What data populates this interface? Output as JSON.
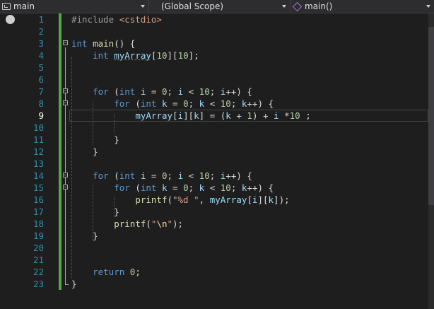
{
  "navbar": {
    "project": "main",
    "scope": "(Global Scope)",
    "member": "main()"
  },
  "editor": {
    "current_line": 9,
    "lines": [
      {
        "n": "1",
        "tokens": [
          {
            "t": "#include ",
            "c": "pp"
          },
          {
            "t": "<cstdio>",
            "c": "inc"
          }
        ]
      },
      {
        "n": "2",
        "tokens": []
      },
      {
        "n": "3",
        "tokens": [
          {
            "t": "int",
            "c": "kw"
          },
          {
            "t": " "
          },
          {
            "t": "main",
            "c": "fn"
          },
          {
            "t": "() {"
          }
        ]
      },
      {
        "n": "4",
        "tokens": [
          {
            "t": "    "
          },
          {
            "t": "int",
            "c": "kw"
          },
          {
            "t": " "
          },
          {
            "t": "myArray",
            "c": "var"
          },
          {
            "t": "["
          },
          {
            "t": "10",
            "c": "num"
          },
          {
            "t": "]["
          },
          {
            "t": "10",
            "c": "num"
          },
          {
            "t": "];"
          }
        ]
      },
      {
        "n": "5",
        "tokens": []
      },
      {
        "n": "6",
        "tokens": []
      },
      {
        "n": "7",
        "tokens": [
          {
            "t": "    "
          },
          {
            "t": "for",
            "c": "kw"
          },
          {
            "t": " ("
          },
          {
            "t": "int",
            "c": "kw"
          },
          {
            "t": " "
          },
          {
            "t": "i",
            "c": "var"
          },
          {
            "t": " = "
          },
          {
            "t": "0",
            "c": "num"
          },
          {
            "t": "; "
          },
          {
            "t": "i",
            "c": "var"
          },
          {
            "t": " < "
          },
          {
            "t": "10",
            "c": "num"
          },
          {
            "t": "; "
          },
          {
            "t": "i",
            "c": "var"
          },
          {
            "t": "++) {"
          }
        ]
      },
      {
        "n": "8",
        "tokens": [
          {
            "t": "        "
          },
          {
            "t": "for",
            "c": "kw"
          },
          {
            "t": " ("
          },
          {
            "t": "int",
            "c": "kw"
          },
          {
            "t": " "
          },
          {
            "t": "k",
            "c": "var"
          },
          {
            "t": " = "
          },
          {
            "t": "0",
            "c": "num"
          },
          {
            "t": "; "
          },
          {
            "t": "k",
            "c": "var"
          },
          {
            "t": " < "
          },
          {
            "t": "10",
            "c": "num"
          },
          {
            "t": "; "
          },
          {
            "t": "k",
            "c": "var"
          },
          {
            "t": "++) {"
          }
        ]
      },
      {
        "n": "9",
        "tokens": [
          {
            "t": "            "
          },
          {
            "t": "myArray",
            "c": "var"
          },
          {
            "t": "["
          },
          {
            "t": "i",
            "c": "var"
          },
          {
            "t": "]["
          },
          {
            "t": "k",
            "c": "var"
          },
          {
            "t": "] = ("
          },
          {
            "t": "k",
            "c": "var"
          },
          {
            "t": " + "
          },
          {
            "t": "1",
            "c": "num"
          },
          {
            "t": ") + "
          },
          {
            "t": "i",
            "c": "var"
          },
          {
            "t": " *"
          },
          {
            "t": "10",
            "c": "num"
          },
          {
            "t": " ;"
          }
        ]
      },
      {
        "n": "10",
        "tokens": []
      },
      {
        "n": "11",
        "tokens": [
          {
            "t": "        }"
          }
        ]
      },
      {
        "n": "12",
        "tokens": [
          {
            "t": "    }"
          }
        ]
      },
      {
        "n": "13",
        "tokens": []
      },
      {
        "n": "14",
        "tokens": [
          {
            "t": "    "
          },
          {
            "t": "for",
            "c": "kw"
          },
          {
            "t": " ("
          },
          {
            "t": "int",
            "c": "kw"
          },
          {
            "t": " "
          },
          {
            "t": "i",
            "c": "var"
          },
          {
            "t": " = "
          },
          {
            "t": "0",
            "c": "num"
          },
          {
            "t": "; "
          },
          {
            "t": "i",
            "c": "var"
          },
          {
            "t": " < "
          },
          {
            "t": "10",
            "c": "num"
          },
          {
            "t": "; "
          },
          {
            "t": "i",
            "c": "var"
          },
          {
            "t": "++) {"
          }
        ]
      },
      {
        "n": "15",
        "tokens": [
          {
            "t": "        "
          },
          {
            "t": "for",
            "c": "kw"
          },
          {
            "t": " ("
          },
          {
            "t": "int",
            "c": "kw"
          },
          {
            "t": " "
          },
          {
            "t": "k",
            "c": "var"
          },
          {
            "t": " = "
          },
          {
            "t": "0",
            "c": "num"
          },
          {
            "t": "; "
          },
          {
            "t": "k",
            "c": "var"
          },
          {
            "t": " < "
          },
          {
            "t": "10",
            "c": "num"
          },
          {
            "t": "; "
          },
          {
            "t": "k",
            "c": "var"
          },
          {
            "t": "++) {"
          }
        ]
      },
      {
        "n": "16",
        "tokens": [
          {
            "t": "            "
          },
          {
            "t": "printf",
            "c": "fn"
          },
          {
            "t": "("
          },
          {
            "t": "\"%d \"",
            "c": "str"
          },
          {
            "t": ", "
          },
          {
            "t": "myArray",
            "c": "var"
          },
          {
            "t": "["
          },
          {
            "t": "i",
            "c": "var"
          },
          {
            "t": "]["
          },
          {
            "t": "k",
            "c": "var"
          },
          {
            "t": "]);"
          }
        ]
      },
      {
        "n": "17",
        "tokens": [
          {
            "t": "        }"
          }
        ]
      },
      {
        "n": "18",
        "tokens": [
          {
            "t": "        "
          },
          {
            "t": "printf",
            "c": "fn"
          },
          {
            "t": "("
          },
          {
            "t": "\"",
            "c": "str"
          },
          {
            "t": "\\n",
            "c": "esc"
          },
          {
            "t": "\"",
            "c": "str"
          },
          {
            "t": ");"
          }
        ]
      },
      {
        "n": "19",
        "tokens": [
          {
            "t": "    }"
          }
        ]
      },
      {
        "n": "20",
        "tokens": []
      },
      {
        "n": "21",
        "tokens": []
      },
      {
        "n": "22",
        "tokens": [
          {
            "t": "    "
          },
          {
            "t": "return",
            "c": "kw"
          },
          {
            "t": " "
          },
          {
            "t": "0",
            "c": "num"
          },
          {
            "t": ";"
          }
        ]
      },
      {
        "n": "23",
        "tokens": [
          {
            "t": "}"
          }
        ]
      }
    ]
  }
}
